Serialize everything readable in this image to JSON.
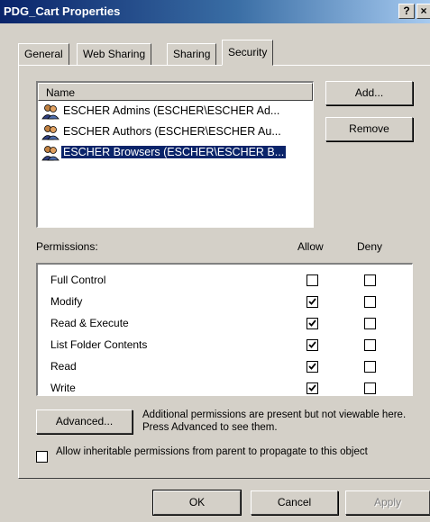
{
  "window": {
    "title": "PDG_Cart Properties",
    "help_glyph": "?",
    "close_glyph": "×"
  },
  "tabs": [
    {
      "label": "General",
      "active": false
    },
    {
      "label": "Web Sharing",
      "active": false
    },
    {
      "label": "Sharing",
      "active": false
    },
    {
      "label": "Security",
      "active": true
    }
  ],
  "names_list": {
    "header": "Name",
    "items": [
      {
        "label": "ESCHER Admins (ESCHER\\ESCHER Ad...",
        "icon": "group-icon",
        "selected": false
      },
      {
        "label": "ESCHER Authors (ESCHER\\ESCHER Au...",
        "icon": "group-icon",
        "selected": false
      },
      {
        "label": "ESCHER Browsers (ESCHER\\ESCHER B...",
        "icon": "group-icon",
        "selected": true
      }
    ]
  },
  "buttons": {
    "add": "Add...",
    "remove": "Remove",
    "advanced": "Advanced...",
    "ok": "OK",
    "cancel": "Cancel",
    "apply": "Apply"
  },
  "permissions": {
    "label": "Permissions:",
    "allow_header": "Allow",
    "deny_header": "Deny",
    "rows": [
      {
        "name": "Full Control",
        "allow": false,
        "deny": false
      },
      {
        "name": "Modify",
        "allow": true,
        "deny": false
      },
      {
        "name": "Read & Execute",
        "allow": true,
        "deny": false
      },
      {
        "name": "List Folder Contents",
        "allow": true,
        "deny": false
      },
      {
        "name": "Read",
        "allow": true,
        "deny": false
      },
      {
        "name": "Write",
        "allow": true,
        "deny": false
      }
    ]
  },
  "advanced_note": "Additional permissions are present but not viewable here. Press Advanced to see them.",
  "inherit": {
    "label": "Allow inheritable permissions from parent to propagate to this object",
    "checked": false
  },
  "colors": {
    "face": "#d4d0c8",
    "selection": "#0a246a",
    "title_gradient_start": "#0a246a",
    "title_gradient_end": "#a6caf0"
  }
}
